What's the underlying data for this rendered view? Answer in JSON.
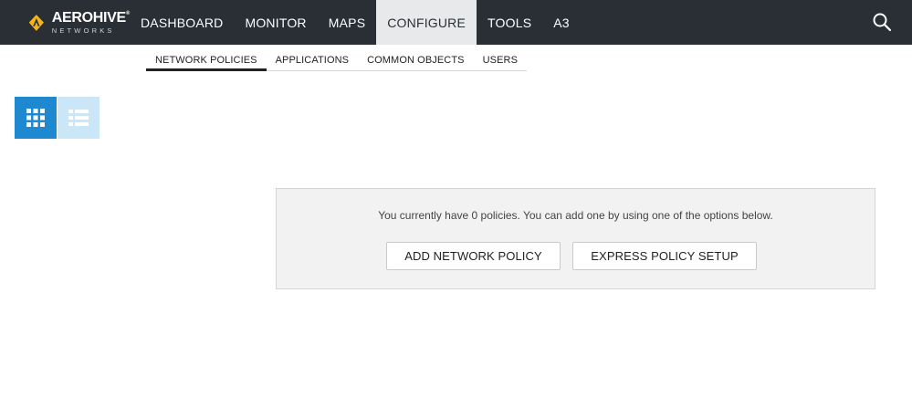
{
  "brand": {
    "name": "AEROHIVE",
    "trademark": "®",
    "subtitle": "NETWORKS",
    "logo_color": "#f5b516"
  },
  "nav": {
    "items": [
      {
        "label": "DASHBOARD",
        "active": false
      },
      {
        "label": "MONITOR",
        "active": false
      },
      {
        "label": "MAPS",
        "active": false
      },
      {
        "label": "CONFIGURE",
        "active": true
      },
      {
        "label": "TOOLS",
        "active": false
      },
      {
        "label": "A3",
        "active": false
      }
    ],
    "search_icon": "search-icon"
  },
  "subtabs": {
    "items": [
      {
        "label": "NETWORK POLICIES",
        "active": true
      },
      {
        "label": "APPLICATIONS",
        "active": false
      },
      {
        "label": "COMMON OBJECTS",
        "active": false
      },
      {
        "label": "USERS",
        "active": false
      }
    ]
  },
  "view_toggle": {
    "grid_icon": "grid-view-icon",
    "list_icon": "list-view-icon",
    "selected": "grid"
  },
  "empty_state": {
    "message": "You currently have 0 policies. You can add one by using one of the options below.",
    "add_button": "ADD NETWORK POLICY",
    "express_button": "EXPRESS POLICY SETUP"
  },
  "colors": {
    "topbar": "#2a2f36",
    "active_nav": "#e8e9ea",
    "accent": "#1e88d1",
    "accent_light": "#cbe6f7"
  }
}
